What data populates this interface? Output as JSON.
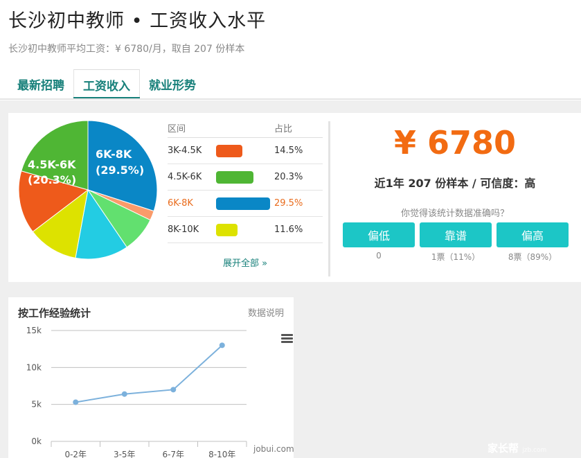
{
  "header": {
    "title": "长沙初中教师 • 工资收入水平",
    "subtitle": "长沙初中教师平均工资：¥ 6780/月，取自 207 份样本"
  },
  "tabs": [
    {
      "label": "最新招聘"
    },
    {
      "label": "工资收入"
    },
    {
      "label": "就业形势"
    }
  ],
  "pie": {
    "label_a_name": "4.5K-6K",
    "label_a_pct": "(20.3%)",
    "label_b_name": "6K-8K",
    "label_b_pct": "(29.5%)"
  },
  "table": {
    "head_range": "区间",
    "head_pct": "占比",
    "rows": [
      {
        "range": "3K-4.5K",
        "pct": "14.5%",
        "color": "#ee5a1b"
      },
      {
        "range": "4.5K-6K",
        "pct": "20.3%",
        "color": "#4fb634"
      },
      {
        "range": "6K-8K",
        "pct": "29.5%",
        "color": "#0a87c6"
      },
      {
        "range": "8K-10K",
        "pct": "11.6%",
        "color": "#dde200"
      }
    ],
    "more": "展开全部 »"
  },
  "pie_slices": [
    {
      "value": 29.5,
      "color": "#0a87c6"
    },
    {
      "value": 2.2,
      "color": "#f99b6a"
    },
    {
      "value": 8.2,
      "color": "#62e06f"
    },
    {
      "value": 12.2,
      "color": "#23cce3"
    },
    {
      "value": 11.6,
      "color": "#dde200"
    },
    {
      "value": 14.5,
      "color": "#ee5a1b"
    },
    {
      "value": 20.3,
      "color": "#4fb634"
    }
  ],
  "summary": {
    "price": "¥ 6780",
    "samples": "近1年 207 份样本 / 可信度：高",
    "question": "你觉得该统计数据准确吗？",
    "votes": [
      {
        "label": "偏低",
        "count": "0"
      },
      {
        "label": "靠谱",
        "count": "1票（11%）"
      },
      {
        "label": "偏高",
        "count": "8票（89%）"
      }
    ]
  },
  "experience": {
    "title": "按工作经验统计",
    "note": "数据说明",
    "watermark": "jobui.com"
  },
  "chart_data": {
    "type": "line",
    "categories": [
      "0-2年",
      "3-5年",
      "6-7年",
      "8-10年"
    ],
    "values": [
      5300,
      6400,
      7000,
      13000
    ],
    "y_ticks": [
      "0k",
      "5k",
      "10k",
      "15k"
    ],
    "ylim": [
      0,
      15000
    ],
    "grid": true,
    "color": "#7cb1dc"
  },
  "site_watermark": {
    "name": "家长帮",
    "domain": "jzb.com"
  }
}
